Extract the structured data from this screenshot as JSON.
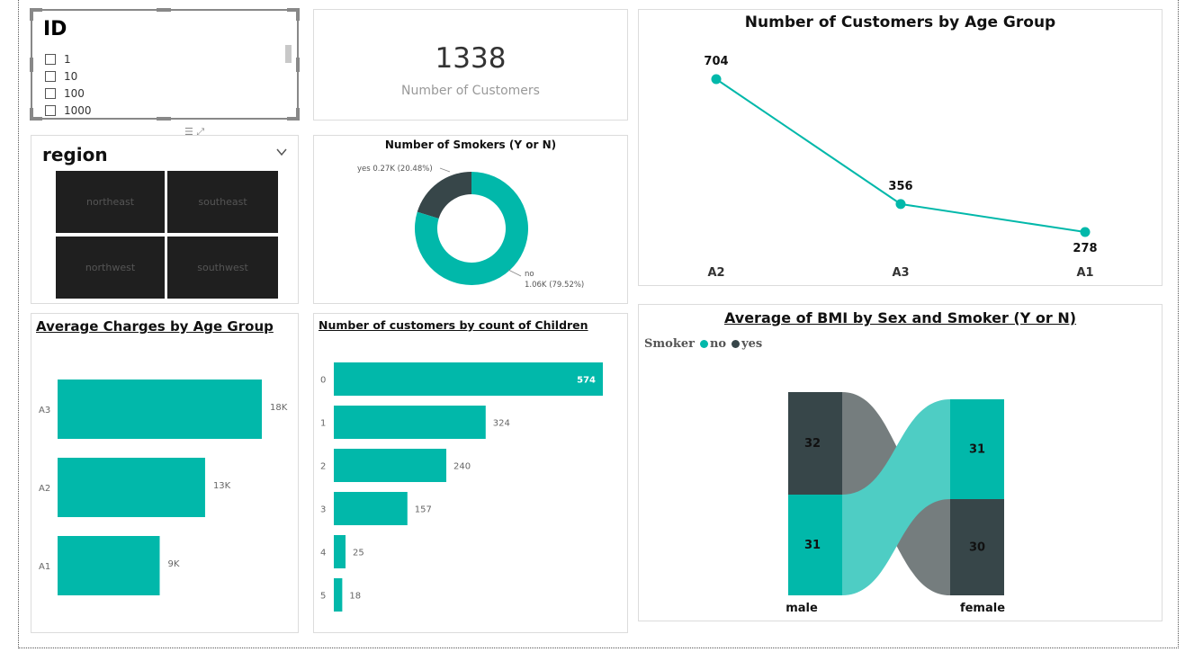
{
  "colors": {
    "teal": "#01B8AA",
    "dark": "#374649",
    "lightTeal": "#4ECDC4",
    "gray": "#757D7E"
  },
  "id_slicer": {
    "title": "ID",
    "items": [
      "1",
      "10",
      "100",
      "1000"
    ]
  },
  "kpi": {
    "value": "1338",
    "label": "Number of Customers"
  },
  "region_slicer": {
    "title": "region",
    "tiles": [
      "northeast",
      "southeast",
      "northwest",
      "southwest"
    ],
    "header_icons": "☰ ⤢"
  },
  "smokers": {
    "title": "Number of Smokers (Y or N)",
    "yes_label": "yes 0.27K (20.48%)",
    "no_label_1": "no",
    "no_label_2": "1.06K (79.52%)"
  },
  "age_group": {
    "title": "Number of Customers by Age Group"
  },
  "charges": {
    "title": "Average Charges by Age Group"
  },
  "children": {
    "title": "Number of customers by count of Children"
  },
  "bmi": {
    "title": "Average of BMI by Sex and Smoker (Y or N)",
    "legend_title": "Smoker",
    "legend_no": "no",
    "legend_yes": "yes",
    "male_label": "male",
    "female_label": "female"
  },
  "chart_data": [
    {
      "type": "pie",
      "title": "Number of Smokers (Y or N)",
      "categories": [
        "yes",
        "no"
      ],
      "values": [
        0.27,
        1.06
      ],
      "percent": [
        20.48,
        79.52
      ],
      "unit": "K"
    },
    {
      "type": "line",
      "title": "Number of Customers by Age Group",
      "categories": [
        "A2",
        "A3",
        "A1"
      ],
      "values": [
        704,
        356,
        278
      ],
      "data_labels": [
        "704",
        "356",
        "278"
      ]
    },
    {
      "type": "bar",
      "title": "Average Charges by Age Group",
      "categories": [
        "A3",
        "A2",
        "A1"
      ],
      "values": [
        18,
        13,
        9
      ],
      "data_labels": [
        "18K",
        "13K",
        "9K"
      ],
      "unit": "K"
    },
    {
      "type": "bar",
      "title": "Number of customers by count of Children",
      "categories": [
        "0",
        "1",
        "2",
        "3",
        "4",
        "5"
      ],
      "values": [
        574,
        324,
        240,
        157,
        25,
        18
      ]
    },
    {
      "type": "bar",
      "title": "Average of BMI by Sex and Smoker (Y or N)",
      "categories": [
        "male",
        "female"
      ],
      "series": [
        {
          "name": "yes",
          "values": [
            32,
            30
          ]
        },
        {
          "name": "no",
          "values": [
            31,
            31
          ]
        }
      ]
    }
  ]
}
